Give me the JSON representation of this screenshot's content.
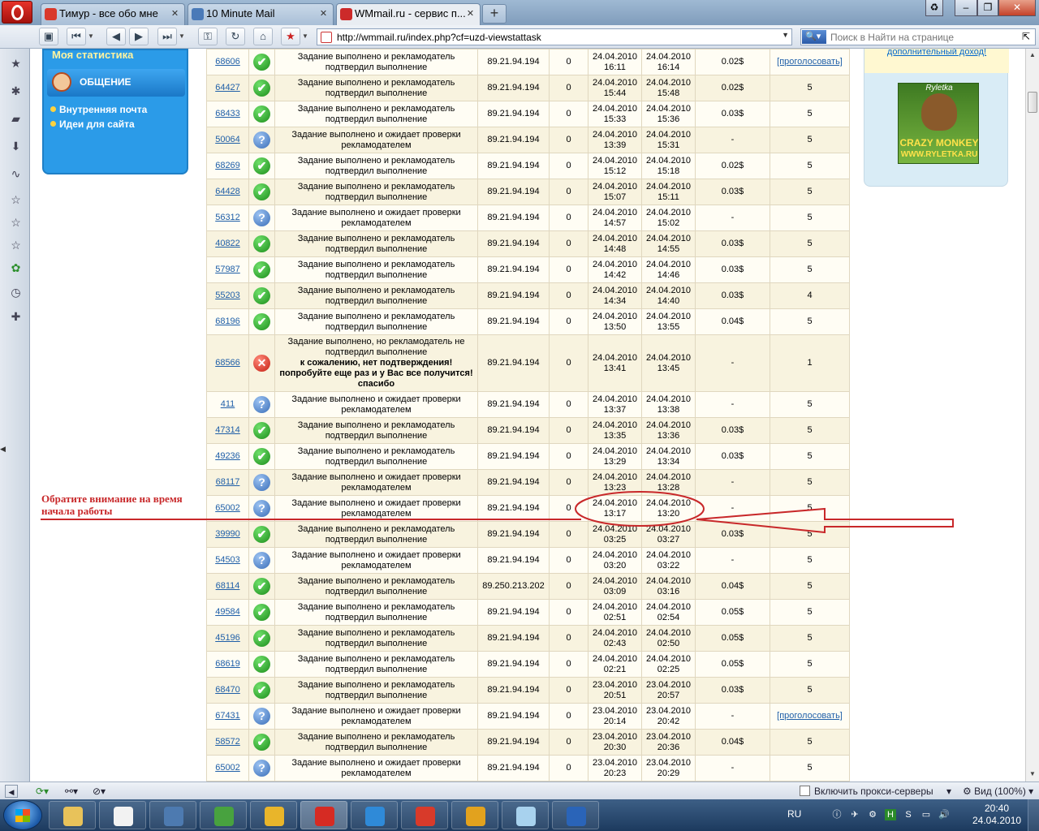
{
  "browser": {
    "tabs": [
      {
        "label": "Тимур - все обо мне",
        "active": false,
        "icon_color": "#d9392b"
      },
      {
        "label": "10 Minute Mail",
        "active": false,
        "icon_color": "#4a7ab8"
      },
      {
        "label": "WMmail.ru - сервис п...",
        "active": true,
        "icon_color": "#cc2a2a"
      }
    ],
    "address": "http://wmmail.ru/index.php?cf=uzd-viewstattask",
    "search_placeholder": "Поиск в Найти на странице"
  },
  "sidebar": {
    "stat_link": "Моя статистика",
    "section_title": "ОБЩЕНИЕ",
    "links": [
      "Внутренняя почта",
      "Идеи для сайта"
    ]
  },
  "right_column": {
    "income_link": "дополнительный доход!",
    "banner": {
      "brand": "Ryletka",
      "line1": "CRAZY MONKEY",
      "line2": "WWW.RYLETKA.RU"
    }
  },
  "annotation": {
    "text": "Обратите внимание на время начала работы",
    "color": "#c8282a"
  },
  "tasks": [
    {
      "id": "68606",
      "status": "ok",
      "desc": "Задание выполнено и рекламодатель подтвердил выполнение",
      "ip": "89.21.94.194",
      "n": "0",
      "start": "24.04.2010 16:11",
      "end": "24.04.2010 16:14",
      "pay": "0.02$",
      "vote": "[проголосовать]",
      "vote_link": true
    },
    {
      "id": "64427",
      "status": "ok",
      "desc": "Задание выполнено и рекламодатель подтвердил выполнение",
      "ip": "89.21.94.194",
      "n": "0",
      "start": "24.04.2010 15:44",
      "end": "24.04.2010 15:48",
      "pay": "0.02$",
      "vote": "5"
    },
    {
      "id": "68433",
      "status": "ok",
      "desc": "Задание выполнено и рекламодатель подтвердил выполнение",
      "ip": "89.21.94.194",
      "n": "0",
      "start": "24.04.2010 15:33",
      "end": "24.04.2010 15:36",
      "pay": "0.03$",
      "vote": "5"
    },
    {
      "id": "50064",
      "status": "wait",
      "desc": "Задание выполнено и ожидает проверки рекламодателем",
      "ip": "89.21.94.194",
      "n": "0",
      "start": "24.04.2010 13:39",
      "end": "24.04.2010 15:31",
      "pay": "-",
      "vote": "5"
    },
    {
      "id": "68269",
      "status": "ok",
      "desc": "Задание выполнено и рекламодатель подтвердил выполнение",
      "ip": "89.21.94.194",
      "n": "0",
      "start": "24.04.2010 15:12",
      "end": "24.04.2010 15:18",
      "pay": "0.02$",
      "vote": "5"
    },
    {
      "id": "64428",
      "status": "ok",
      "desc": "Задание выполнено и рекламодатель подтвердил выполнение",
      "ip": "89.21.94.194",
      "n": "0",
      "start": "24.04.2010 15:07",
      "end": "24.04.2010 15:11",
      "pay": "0.03$",
      "vote": "5"
    },
    {
      "id": "56312",
      "status": "wait",
      "desc": "Задание выполнено и ожидает проверки рекламодателем",
      "ip": "89.21.94.194",
      "n": "0",
      "start": "24.04.2010 14:57",
      "end": "24.04.2010 15:02",
      "pay": "-",
      "vote": "5"
    },
    {
      "id": "40822",
      "status": "ok",
      "desc": "Задание выполнено и рекламодатель подтвердил выполнение",
      "ip": "89.21.94.194",
      "n": "0",
      "start": "24.04.2010 14:48",
      "end": "24.04.2010 14:55",
      "pay": "0.03$",
      "vote": "5"
    },
    {
      "id": "57987",
      "status": "ok",
      "desc": "Задание выполнено и рекламодатель подтвердил выполнение",
      "ip": "89.21.94.194",
      "n": "0",
      "start": "24.04.2010 14:42",
      "end": "24.04.2010 14:46",
      "pay": "0.03$",
      "vote": "5"
    },
    {
      "id": "55203",
      "status": "ok",
      "desc": "Задание выполнено и рекламодатель подтвердил выполнение",
      "ip": "89.21.94.194",
      "n": "0",
      "start": "24.04.2010 14:34",
      "end": "24.04.2010 14:40",
      "pay": "0.03$",
      "vote": "4"
    },
    {
      "id": "68196",
      "status": "ok",
      "desc": "Задание выполнено и рекламодатель подтвердил выполнение",
      "ip": "89.21.94.194",
      "n": "0",
      "start": "24.04.2010 13:50",
      "end": "24.04.2010 13:55",
      "pay": "0.04$",
      "vote": "5"
    },
    {
      "id": "68566",
      "status": "err",
      "desc": "Задание выполнено, но рекламодатель не подтвердил выполнение",
      "reason": "к сожалению, нет подтверждения! попробуйте еще раз и у Вас все получится! спасибо",
      "ip": "89.21.94.194",
      "n": "0",
      "start": "24.04.2010 13:41",
      "end": "24.04.2010 13:45",
      "pay": "-",
      "vote": "1",
      "tall": true
    },
    {
      "id": "411",
      "status": "wait",
      "desc": "Задание выполнено и ожидает проверки рекламодателем",
      "ip": "89.21.94.194",
      "n": "0",
      "start": "24.04.2010 13:37",
      "end": "24.04.2010 13:38",
      "pay": "-",
      "vote": "5"
    },
    {
      "id": "47314",
      "status": "ok",
      "desc": "Задание выполнено и рекламодатель подтвердил выполнение",
      "ip": "89.21.94.194",
      "n": "0",
      "start": "24.04.2010 13:35",
      "end": "24.04.2010 13:36",
      "pay": "0.03$",
      "vote": "5"
    },
    {
      "id": "49236",
      "status": "ok",
      "desc": "Задание выполнено и рекламодатель подтвердил выполнение",
      "ip": "89.21.94.194",
      "n": "0",
      "start": "24.04.2010 13:29",
      "end": "24.04.2010 13:34",
      "pay": "0.03$",
      "vote": "5"
    },
    {
      "id": "68117",
      "status": "wait",
      "desc": "Задание выполнено и ожидает проверки рекламодателем",
      "ip": "89.21.94.194",
      "n": "0",
      "start": "24.04.2010 13:23",
      "end": "24.04.2010 13:28",
      "pay": "-",
      "vote": "5"
    },
    {
      "id": "65002",
      "status": "wait",
      "desc": "Задание выполнено и ожидает проверки рекламодателем",
      "ip": "89.21.94.194",
      "n": "0",
      "start": "24.04.2010 13:17",
      "end": "24.04.2010 13:20",
      "pay": "-",
      "vote": "5"
    },
    {
      "id": "39990",
      "status": "ok",
      "desc": "Задание выполнено и рекламодатель подтвердил выполнение",
      "ip": "89.21.94.194",
      "n": "0",
      "start": "24.04.2010 03:25",
      "end": "24.04.2010 03:27",
      "pay": "0.03$",
      "vote": "5"
    },
    {
      "id": "54503",
      "status": "wait",
      "desc": "Задание выполнено и ожидает проверки рекламодателем",
      "ip": "89.21.94.194",
      "n": "0",
      "start": "24.04.2010 03:20",
      "end": "24.04.2010 03:22",
      "pay": "-",
      "vote": "5"
    },
    {
      "id": "68114",
      "status": "ok",
      "desc": "Задание выполнено и рекламодатель подтвердил выполнение",
      "ip": "89.250.213.202",
      "n": "0",
      "start": "24.04.2010 03:09",
      "end": "24.04.2010 03:16",
      "pay": "0.04$",
      "vote": "5"
    },
    {
      "id": "49584",
      "status": "ok",
      "desc": "Задание выполнено и рекламодатель подтвердил выполнение",
      "ip": "89.21.94.194",
      "n": "0",
      "start": "24.04.2010 02:51",
      "end": "24.04.2010 02:54",
      "pay": "0.05$",
      "vote": "5"
    },
    {
      "id": "45196",
      "status": "ok",
      "desc": "Задание выполнено и рекламодатель подтвердил выполнение",
      "ip": "89.21.94.194",
      "n": "0",
      "start": "24.04.2010 02:43",
      "end": "24.04.2010 02:50",
      "pay": "0.05$",
      "vote": "5"
    },
    {
      "id": "68619",
      "status": "ok",
      "desc": "Задание выполнено и рекламодатель подтвердил выполнение",
      "ip": "89.21.94.194",
      "n": "0",
      "start": "24.04.2010 02:21",
      "end": "24.04.2010 02:25",
      "pay": "0.05$",
      "vote": "5"
    },
    {
      "id": "68470",
      "status": "ok",
      "desc": "Задание выполнено и рекламодатель подтвердил выполнение",
      "ip": "89.21.94.194",
      "n": "0",
      "start": "23.04.2010 20:51",
      "end": "23.04.2010 20:57",
      "pay": "0.03$",
      "vote": "5"
    },
    {
      "id": "67431",
      "status": "wait",
      "desc": "Задание выполнено и ожидает проверки рекламодателем",
      "ip": "89.21.94.194",
      "n": "0",
      "start": "23.04.2010 20:14",
      "end": "23.04.2010 20:42",
      "pay": "-",
      "vote": "[проголосовать]",
      "vote_link": true
    },
    {
      "id": "58572",
      "status": "ok",
      "desc": "Задание выполнено и рекламодатель подтвердил выполнение",
      "ip": "89.21.94.194",
      "n": "0",
      "start": "23.04.2010 20:30",
      "end": "23.04.2010 20:36",
      "pay": "0.04$",
      "vote": "5"
    },
    {
      "id": "65002",
      "status": "wait",
      "desc": "Задание выполнено и ожидает проверки рекламодателем",
      "ip": "89.21.94.194",
      "n": "0",
      "start": "23.04.2010 20:23",
      "end": "23.04.2010 20:29",
      "pay": "-",
      "vote": "5"
    }
  ],
  "statusbar": {
    "proxy_label": "Включить прокси-серверы",
    "zoom_label": "Вид (100%)"
  },
  "taskbar": {
    "apps": [
      {
        "name": "explorer",
        "color": "#e8c25a"
      },
      {
        "name": "notepad",
        "color": "#f2f2f2"
      },
      {
        "name": "app-yu",
        "color": "#4d7ab0"
      },
      {
        "name": "app-green",
        "color": "#48a23f"
      },
      {
        "name": "chrome",
        "color": "#e9b52a"
      },
      {
        "name": "opera",
        "color": "#d62b23",
        "active": true
      },
      {
        "name": "ie",
        "color": "#2f8ad8"
      },
      {
        "name": "app-red",
        "color": "#d83a2a"
      },
      {
        "name": "app-orange",
        "color": "#e2a21e"
      },
      {
        "name": "app-glass",
        "color": "#a8d2ee"
      },
      {
        "name": "help",
        "color": "#2a64b8"
      }
    ],
    "language": "RU",
    "time": "20:40",
    "date": "24.04.2010"
  }
}
